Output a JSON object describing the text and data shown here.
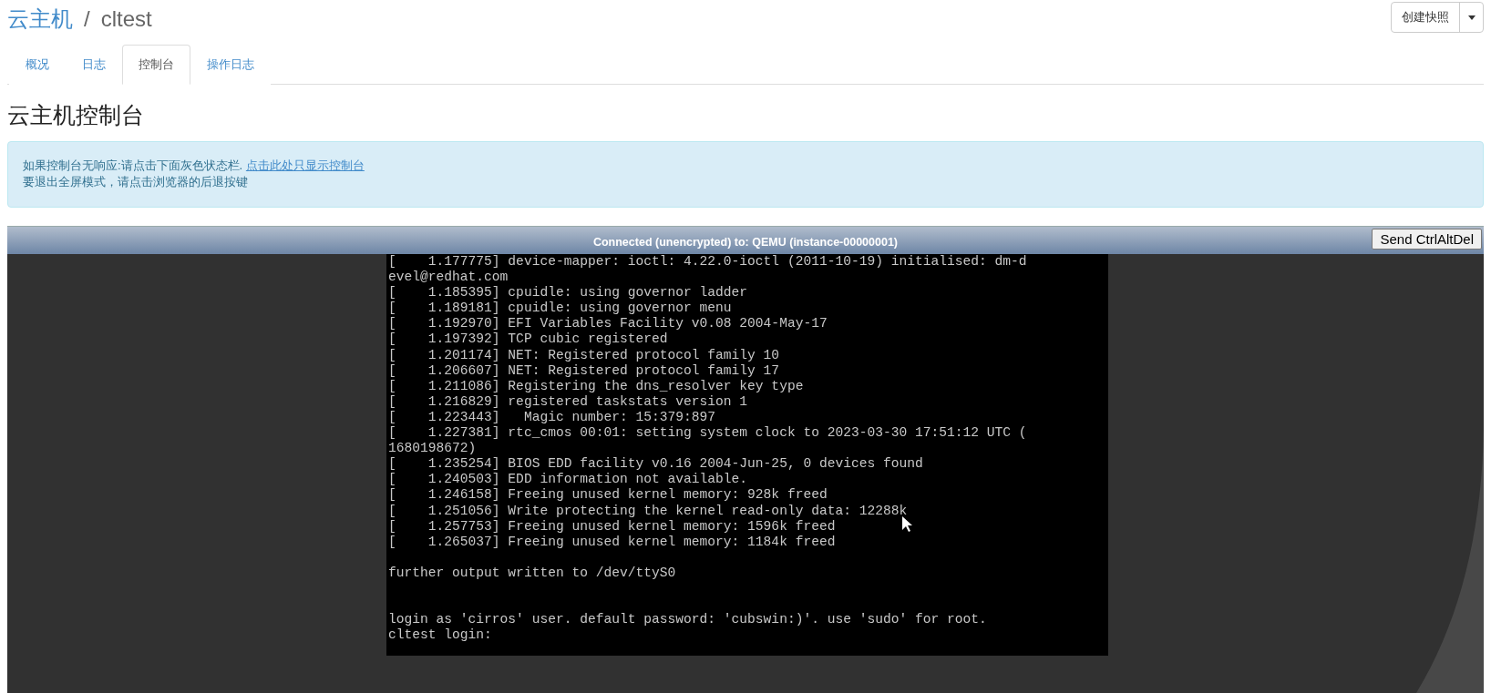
{
  "breadcrumb": {
    "parent": "云主机",
    "separator": "/",
    "current": "cltest"
  },
  "snapshot_button": {
    "label": "创建快照"
  },
  "tabs": [
    {
      "label": "概况",
      "selected": false
    },
    {
      "label": "日志",
      "selected": false
    },
    {
      "label": "控制台",
      "selected": true
    },
    {
      "label": "操作日志",
      "selected": false
    }
  ],
  "heading": "云主机控制台",
  "alert": {
    "line_1": "如果控制台无响应:请点击下面灰色状态栏.",
    "link": "点击此处只显示控制台",
    "line_2": "要退出全屏模式，请点击浏览器的后退按键"
  },
  "console": {
    "status": "Connected (unencrypted) to: QEMU (instance-00000001)",
    "button": "Send CtrlAltDel",
    "blocks": [
      {
        "kind": "log",
        "lines": [
          "[    1.177775] device-mapper: ioctl: 4.22.0-ioctl (2011-10-19) initialised: dm-d",
          "evel@redhat.com",
          "[    1.185395] cpuidle: using governor ladder",
          "[    1.189181] cpuidle: using governor menu",
          "[    1.192970] EFI Variables Facility v0.08 2004-May-17",
          "[    1.197392] TCP cubic registered",
          "[    1.201174] NET: Registered protocol family 10",
          "[    1.206607] NET: Registered protocol family 17",
          "[    1.211086] Registering the dns_resolver key type",
          "[    1.216829] registered taskstats version 1",
          "[    1.223443]   Magic number: 15:379:897",
          "[    1.227381] rtc_cmos 00:01: setting system clock to 2023-03-30 17:51:12 UTC (",
          "1680198672)",
          "[    1.235254] BIOS EDD facility v0.16 2004-Jun-25, 0 devices found",
          "[    1.240503] EDD information not available.",
          "[    1.246158] Freeing unused kernel memory: 928k freed",
          "[    1.251056] Write protecting the kernel read-only data: 12288k",
          "[    1.257753] Freeing unused kernel memory: 1596k freed",
          "[    1.265037] Freeing unused kernel memory: 1184k freed"
        ]
      },
      {
        "kind": "notice",
        "lines": [
          "further output written to /dev/ttyS0"
        ]
      },
      {
        "kind": "login",
        "lines": [
          "login as 'cirros' user. default password: 'cubswin:)'. use 'sudo' for root.",
          "cltest login:"
        ]
      }
    ]
  }
}
